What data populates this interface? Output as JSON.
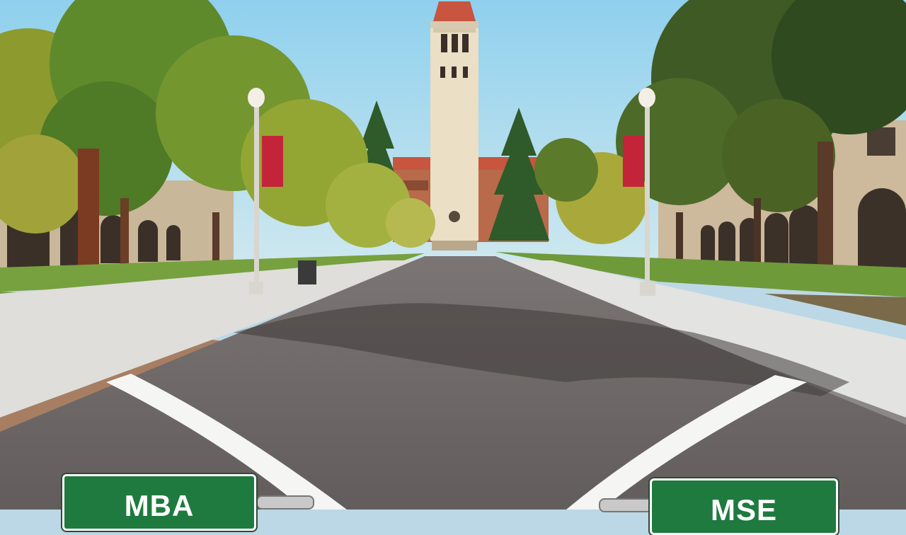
{
  "scene": {
    "description_colors": {
      "sky": "#a9d8ec",
      "road": "#6f6a68",
      "grass": "#6f9a3a",
      "tower": "#e8dcc2",
      "tower_roof": "#c8553f",
      "banner": "#c4243a",
      "sign_green": "#1f7a3f"
    }
  },
  "signs": {
    "left_label": "MBA",
    "right_label": "MSE"
  }
}
